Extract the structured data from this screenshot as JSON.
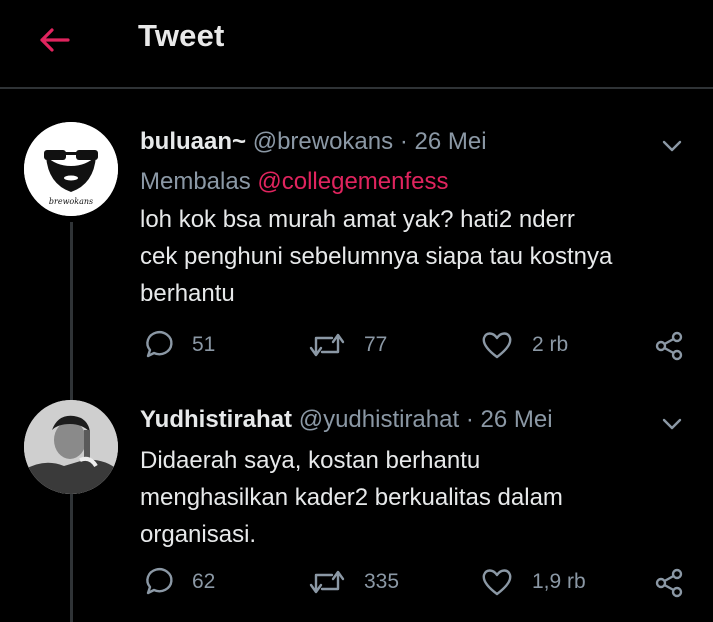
{
  "header": {
    "title": "Tweet",
    "back_icon": "arrow-left-icon",
    "accent": "#e0245e"
  },
  "tweets": [
    {
      "name": "buluaan~",
      "handle": "@brewokans",
      "dot": "·",
      "date": "26 Mei",
      "reply_prefix": "Membalas",
      "reply_to": "@collegemenfess",
      "avatar_text": "brewokans",
      "lines": [
        "loh kok bsa murah amat yak? hati2 nderr",
        "cek penghuni sebelumnya siapa tau kostnya",
        "berhantu"
      ],
      "replies": "51",
      "retweets": "77",
      "likes": "2 rb"
    },
    {
      "name": "Yudhistirahat",
      "handle": "@yudhistirahat",
      "dot": "·",
      "date": "26 Mei",
      "lines": [
        "Didaerah saya, kostan berhantu",
        "menghasilkan kader2 berkualitas dalam",
        "organisasi."
      ],
      "replies": "62",
      "retweets": "335",
      "likes": "1,9 rb"
    }
  ],
  "icons": {
    "reply": "reply-icon",
    "retweet": "retweet-icon",
    "like": "heart-icon",
    "share": "share-icon",
    "caret": "chevron-down-icon"
  }
}
